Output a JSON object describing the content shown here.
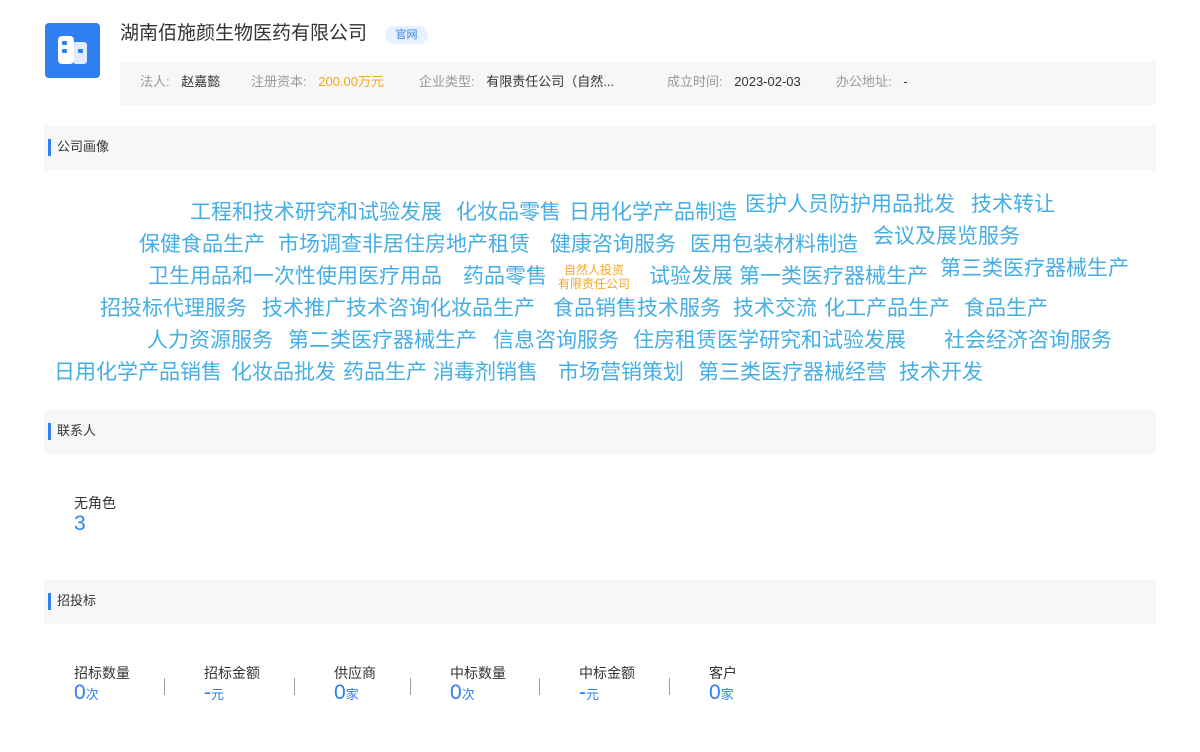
{
  "company": {
    "name": "湖南佰施颜生物医药有限公司",
    "official_badge": "官网"
  },
  "info": {
    "legal_rep_label": "法人:",
    "legal_rep": "赵嘉懿",
    "capital_label": "注册资本:",
    "capital": "200.00万元",
    "type_label": "企业类型:",
    "type": "有限责任公司（自然...",
    "founded_label": "成立时间:",
    "founded": "2023-02-03",
    "address_label": "办公地址:",
    "address": "-"
  },
  "sections": {
    "portrait": "公司画像",
    "contacts": "联系人",
    "bidding": "招投标"
  },
  "tags": [
    "工程和技术研究和试验发展",
    "化妆品零售",
    "日用化学产品制造",
    "医护人员防护用品批发",
    "技术转让",
    "保健食品生产",
    "市场调查",
    "非居住房地产租赁",
    "健康咨询服务",
    "医用包装材料制造",
    "会议及展览服务",
    "卫生用品和一次性使用医疗用品",
    "药品零售",
    "试验发展",
    "第一类医疗器械生产",
    "第三类医疗器械生产",
    "招投标代理服务",
    "技术推广",
    "技术咨询",
    "化妆品生产",
    "食品销售",
    "技术服务",
    "技术交流",
    "化工产品生产",
    "食品生产",
    "人力资源服务",
    "第二类医疗器械生产",
    "信息咨询服务",
    "住房租赁",
    "医学研究和试验发展",
    "社会经济咨询服务",
    "日用化学产品销售",
    "化妆品批发",
    "药品生产",
    "消毒剂销售",
    "市场营销策划",
    "第三类医疗器械经营",
    "技术开发"
  ],
  "tag_small": {
    "line1": "自然人投资",
    "line2": "有限责任公司"
  },
  "contacts": {
    "role_label": "无角色",
    "role_count": "3"
  },
  "bidding": {
    "items": [
      {
        "label": "招标数量",
        "value": "0",
        "unit": "次"
      },
      {
        "label": "招标金额",
        "value": "-",
        "unit": "元"
      },
      {
        "label": "供应商",
        "value": "0",
        "unit": "家"
      },
      {
        "label": "中标数量",
        "value": "0",
        "unit": "次"
      },
      {
        "label": "中标金额",
        "value": "-",
        "unit": "元"
      },
      {
        "label": "客户",
        "value": "0",
        "unit": "家"
      }
    ]
  },
  "colors": {
    "accent": "#2f7ff2",
    "tag": "#44aee5",
    "orange": "#f5a623"
  }
}
